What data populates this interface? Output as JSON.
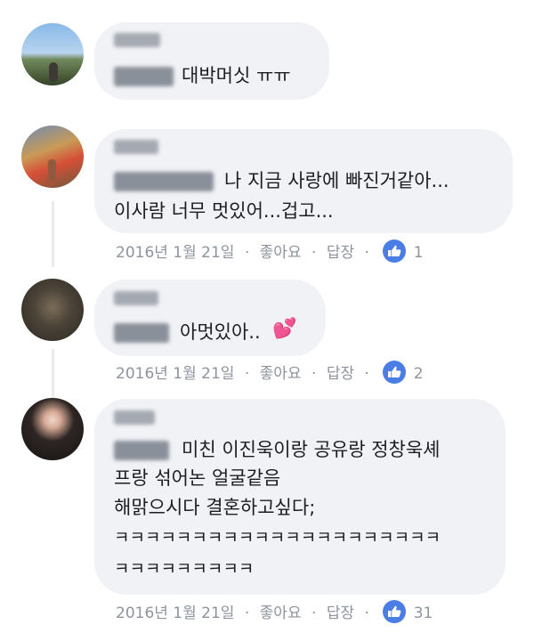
{
  "comments": [
    {
      "id": "c1",
      "text_lines": [
        "대박머싯 ㅠㅠ"
      ],
      "icons": {
        "like": "thumbs-up-icon"
      }
    },
    {
      "id": "c2",
      "text_lines": [
        "나 지금 사랑에 빠진거같아...",
        "이사람 너무 멋있어...겁고..."
      ],
      "meta": {
        "date": "2016년 1월 21일",
        "like_label": "좋아요",
        "reply_label": "답장",
        "like_count": "1"
      }
    },
    {
      "id": "c3",
      "text_lines": [
        "아멋있아.."
      ],
      "meta": {
        "date": "2016년 1월 21일",
        "like_label": "좋아요",
        "reply_label": "답장",
        "like_count": "2"
      }
    },
    {
      "id": "c4",
      "text_lines": [
        "미친 이진욱이랑 공유랑 정창욱셰",
        "프랑 섞어논 얼굴같음",
        "해맑으시다 결혼하고싶다;",
        "ㅋㅋㅋㅋㅋㅋㅋㅋㅋㅋㅋㅋㅋㅋㅋㅋㅋㅋㅋㅋㅋ",
        "ㅋㅋㅋㅋㅋㅋㅋㅋㅋ"
      ],
      "meta": {
        "date": "2016년 1월 21일",
        "like_label": "좋아요",
        "reply_label": "답장",
        "like_count": "31"
      }
    }
  ],
  "ui": {
    "separator": "·",
    "heart_emoji": "💕"
  },
  "icons": {
    "like": "thumbs-up-icon",
    "heart": "two-hearts-icon"
  },
  "colors": {
    "bubble": "#f1f2f5",
    "text": "#1c1e21",
    "meta": "#8d949e",
    "like_badge": "#4a7ee6"
  }
}
